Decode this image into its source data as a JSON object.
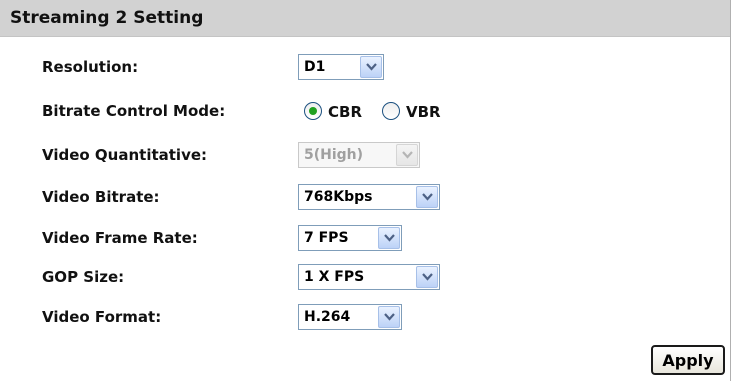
{
  "header": {
    "title": "Streaming 2 Setting"
  },
  "fields": {
    "resolution": {
      "label": "Resolution:",
      "value": "D1"
    },
    "bitrate_mode": {
      "label": "Bitrate Control Mode:",
      "options": [
        "CBR",
        "VBR"
      ],
      "selected": "CBR"
    },
    "video_quantitative": {
      "label": "Video Quantitative:",
      "value": "5(High)",
      "disabled": true
    },
    "video_bitrate": {
      "label": "Video Bitrate:",
      "value": "768Kbps"
    },
    "frame_rate": {
      "label": "Video Frame Rate:",
      "value": "7 FPS"
    },
    "gop_size": {
      "label": "GOP Size:",
      "value": "1 X FPS"
    },
    "video_format": {
      "label": "Video Format:",
      "value": "H.264"
    }
  },
  "apply_label": "Apply",
  "colors": {
    "header_bg": "#d2d2d2",
    "select_border": "#7f9db9",
    "radio_selected": "#21a121"
  },
  "icons": {
    "dropdown": "chevron-down-icon"
  }
}
